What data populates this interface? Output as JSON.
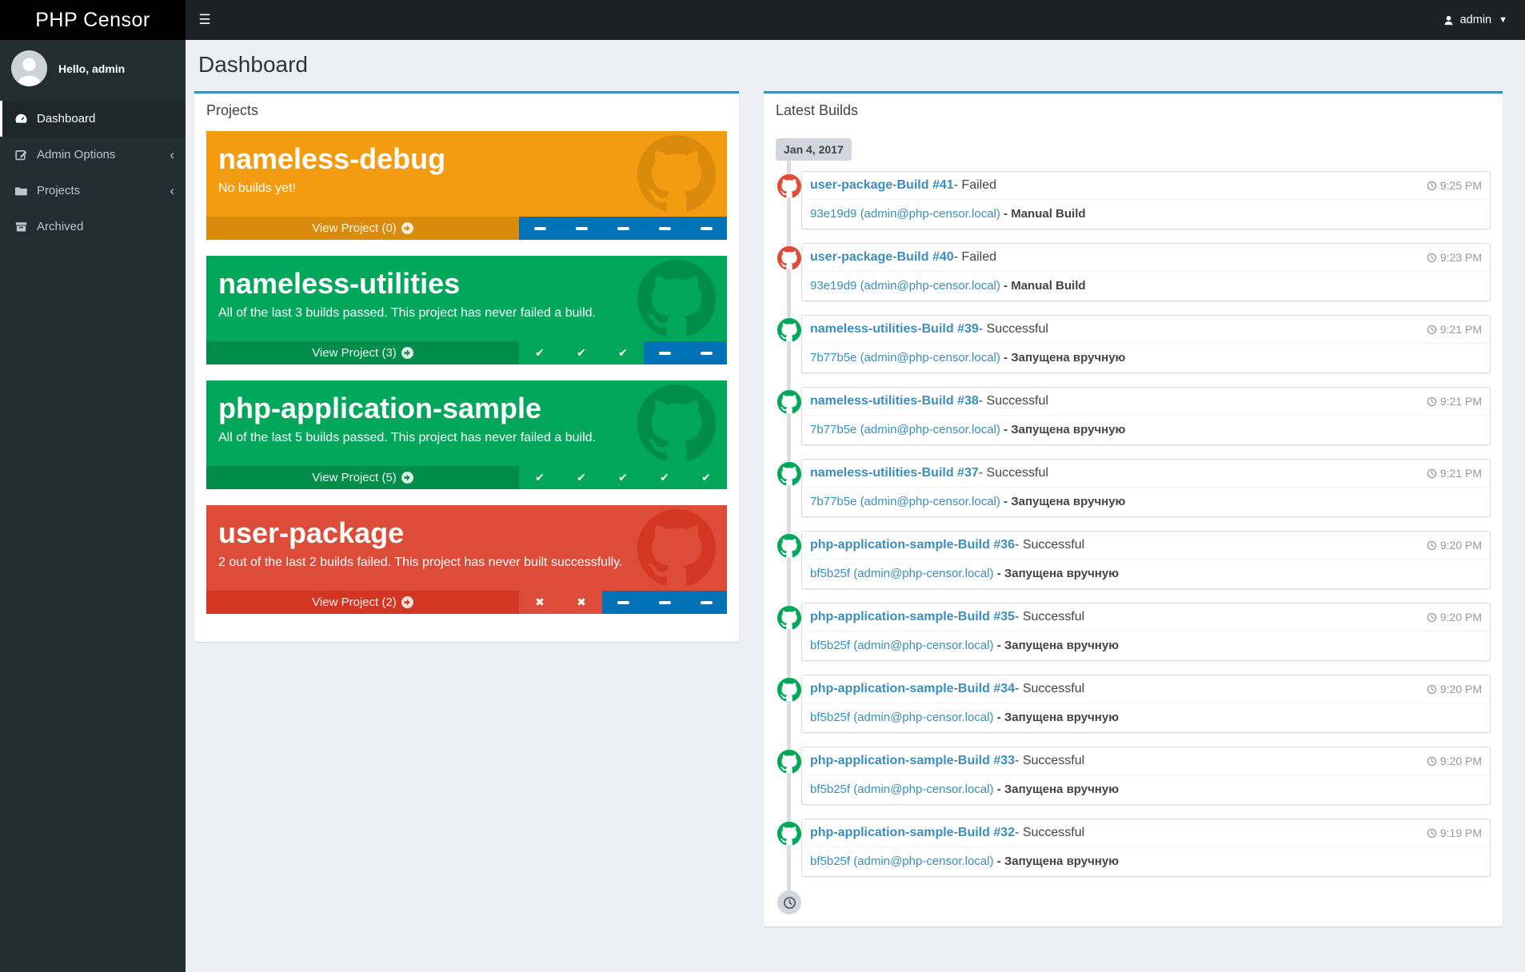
{
  "brand": {
    "title": "PHP Censor"
  },
  "navbar": {
    "user_label": "admin"
  },
  "sidebar": {
    "greeting": "Hello, admin",
    "items": [
      {
        "label": "Dashboard",
        "icon": "tachometer-icon",
        "active": true
      },
      {
        "label": "Admin Options",
        "icon": "edit-icon",
        "active": false,
        "chevron": "‹"
      },
      {
        "label": "Projects",
        "icon": "folder-icon",
        "active": false,
        "chevron": "‹"
      },
      {
        "label": "Archived",
        "icon": "archive-icon",
        "active": false
      }
    ]
  },
  "page": {
    "title": "Dashboard"
  },
  "projects_panel": {
    "title": "Projects",
    "cards": [
      {
        "name": "nameless-debug",
        "description": "No builds yet!",
        "view_label": "View Project (0)",
        "color": "#f39c12",
        "footer_color": "#db8b0b",
        "statuses": [
          "pending",
          "pending",
          "pending",
          "pending",
          "pending"
        ]
      },
      {
        "name": "nameless-utilities",
        "description": "All of the last 3 builds passed. This project has never failed a build.",
        "view_label": "View Project (3)",
        "color": "#00a65a",
        "footer_color": "#008d4c",
        "statuses": [
          "ok",
          "ok",
          "ok",
          "pending",
          "pending"
        ]
      },
      {
        "name": "php-application-sample",
        "description": "All of the last 5 builds passed. This project has never failed a build.",
        "view_label": "View Project (5)",
        "color": "#00a65a",
        "footer_color": "#008d4c",
        "statuses": [
          "ok",
          "ok",
          "ok",
          "ok",
          "ok"
        ]
      },
      {
        "name": "user-package",
        "description": "2 out of the last 2 builds failed. This project has never built successfully.",
        "view_label": "View Project (2)",
        "color": "#dd4b39",
        "footer_color": "#d33724",
        "statuses": [
          "fail",
          "fail",
          "pending",
          "pending",
          "pending"
        ]
      }
    ]
  },
  "builds_panel": {
    "title": "Latest Builds",
    "date_label": "Jan 4, 2017",
    "separator": " - ",
    "items": [
      {
        "project": "user-package",
        "build": "Build #41",
        "status": "Failed",
        "status_color": "#dd4b39",
        "commit": "93e19d9 (admin@php-censor.local)",
        "note": "Manual Build",
        "time": "9:25 PM",
        "icon": "github-icon"
      },
      {
        "project": "user-package",
        "build": "Build #40",
        "status": "Failed",
        "status_color": "#dd4b39",
        "commit": "93e19d9 (admin@php-censor.local)",
        "note": "Manual Build",
        "time": "9:23 PM",
        "icon": "github-icon"
      },
      {
        "project": "nameless-utilities",
        "build": "Build #39",
        "status": "Successful",
        "status_color": "#00a65a",
        "commit": "7b77b5e (admin@php-censor.local)",
        "note": "Запущена вручную",
        "time": "9:21 PM",
        "icon": "github-icon"
      },
      {
        "project": "nameless-utilities",
        "build": "Build #38",
        "status": "Successful",
        "status_color": "#00a65a",
        "commit": "7b77b5e (admin@php-censor.local)",
        "note": "Запущена вручную",
        "time": "9:21 PM",
        "icon": "github-icon"
      },
      {
        "project": "nameless-utilities",
        "build": "Build #37",
        "status": "Successful",
        "status_color": "#00a65a",
        "commit": "7b77b5e (admin@php-censor.local)",
        "note": "Запущена вручную",
        "time": "9:21 PM",
        "icon": "github-icon"
      },
      {
        "project": "php-application-sample",
        "build": "Build #36",
        "status": "Successful",
        "status_color": "#00a65a",
        "commit": "bf5b25f (admin@php-censor.local)",
        "note": "Запущена вручную",
        "time": "9:20 PM",
        "icon": "github-icon"
      },
      {
        "project": "php-application-sample",
        "build": "Build #35",
        "status": "Successful",
        "status_color": "#00a65a",
        "commit": "bf5b25f (admin@php-censor.local)",
        "note": "Запущена вручную",
        "time": "9:20 PM",
        "icon": "github-icon"
      },
      {
        "project": "php-application-sample",
        "build": "Build #34",
        "status": "Successful",
        "status_color": "#00a65a",
        "commit": "bf5b25f (admin@php-censor.local)",
        "note": "Запущена вручную",
        "time": "9:20 PM",
        "icon": "github-icon"
      },
      {
        "project": "php-application-sample",
        "build": "Build #33",
        "status": "Successful",
        "status_color": "#00a65a",
        "commit": "bf5b25f (admin@php-censor.local)",
        "note": "Запущена вручную",
        "time": "9:20 PM",
        "icon": "github-icon"
      },
      {
        "project": "php-application-sample",
        "build": "Build #32",
        "status": "Successful",
        "status_color": "#00a65a",
        "commit": "bf5b25f (admin@php-censor.local)",
        "note": "Запущена вручную",
        "time": "9:19 PM",
        "icon": "github-icon"
      }
    ]
  },
  "colors": {
    "accent": "#3c8dbc",
    "success": "#00a65a",
    "failure": "#dd4b39",
    "warning": "#f39c12",
    "pending": "#0073b7",
    "sidebar_bg": "#222d32",
    "content_bg": "#ecf0f5",
    "topbar_bg": "#1a2226"
  }
}
